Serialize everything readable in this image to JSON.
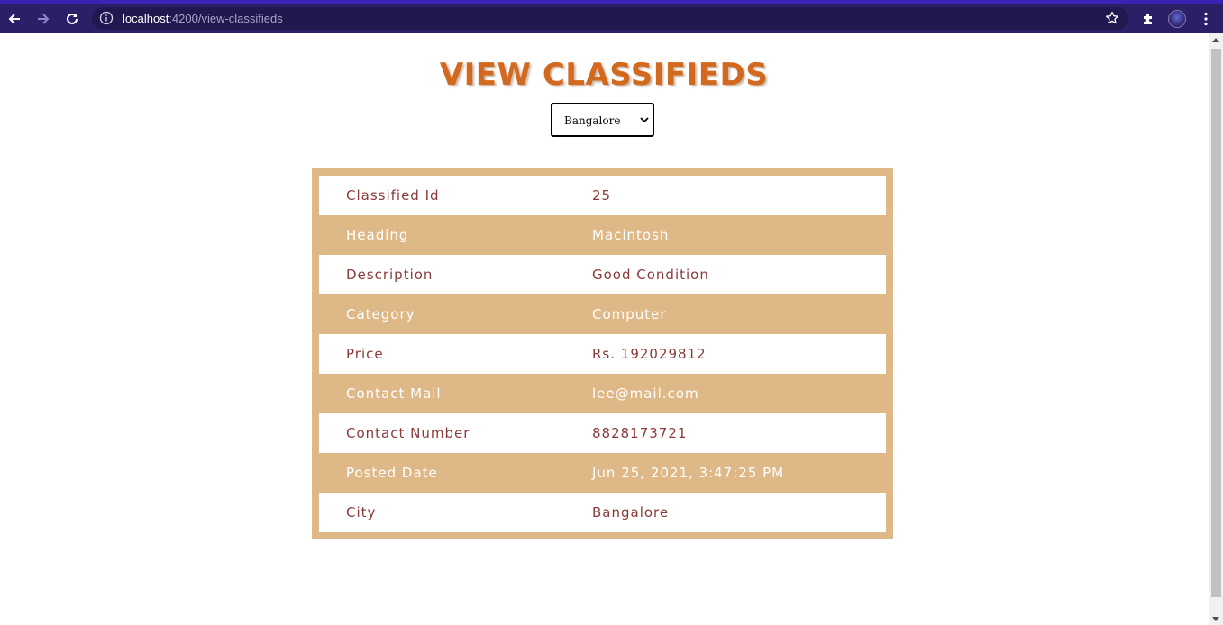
{
  "browser": {
    "url_host": "localhost",
    "url_path": ":4200/view-classifieds"
  },
  "page": {
    "title": "VIEW CLASSIFIEDS",
    "city_select": {
      "selected": "Bangalore"
    }
  },
  "classified": {
    "rows": [
      {
        "label": "Classified Id",
        "value": "25"
      },
      {
        "label": "Heading",
        "value": "Macintosh"
      },
      {
        "label": "Description",
        "value": "Good Condition"
      },
      {
        "label": "Category",
        "value": "Computer"
      },
      {
        "label": "Price",
        "value": "Rs. 192029812"
      },
      {
        "label": "Contact Mail",
        "value": "lee@mail.com"
      },
      {
        "label": "Contact Number",
        "value": "8828173721"
      },
      {
        "label": "Posted Date",
        "value": "Jun 25, 2021, 3:47:25 PM"
      },
      {
        "label": "City",
        "value": "Bangalore"
      }
    ]
  },
  "colors": {
    "title": "#d2691e",
    "table_accent": "#deb887",
    "text_dark_rows": "#8b3a3a",
    "browser_bar": "#2b1f68"
  },
  "icons": [
    "back-arrow-icon",
    "forward-arrow-icon",
    "reload-icon",
    "info-icon",
    "star-icon",
    "extensions-icon",
    "profile-avatar-icon",
    "more-menu-icon",
    "chevron-down-icon"
  ]
}
